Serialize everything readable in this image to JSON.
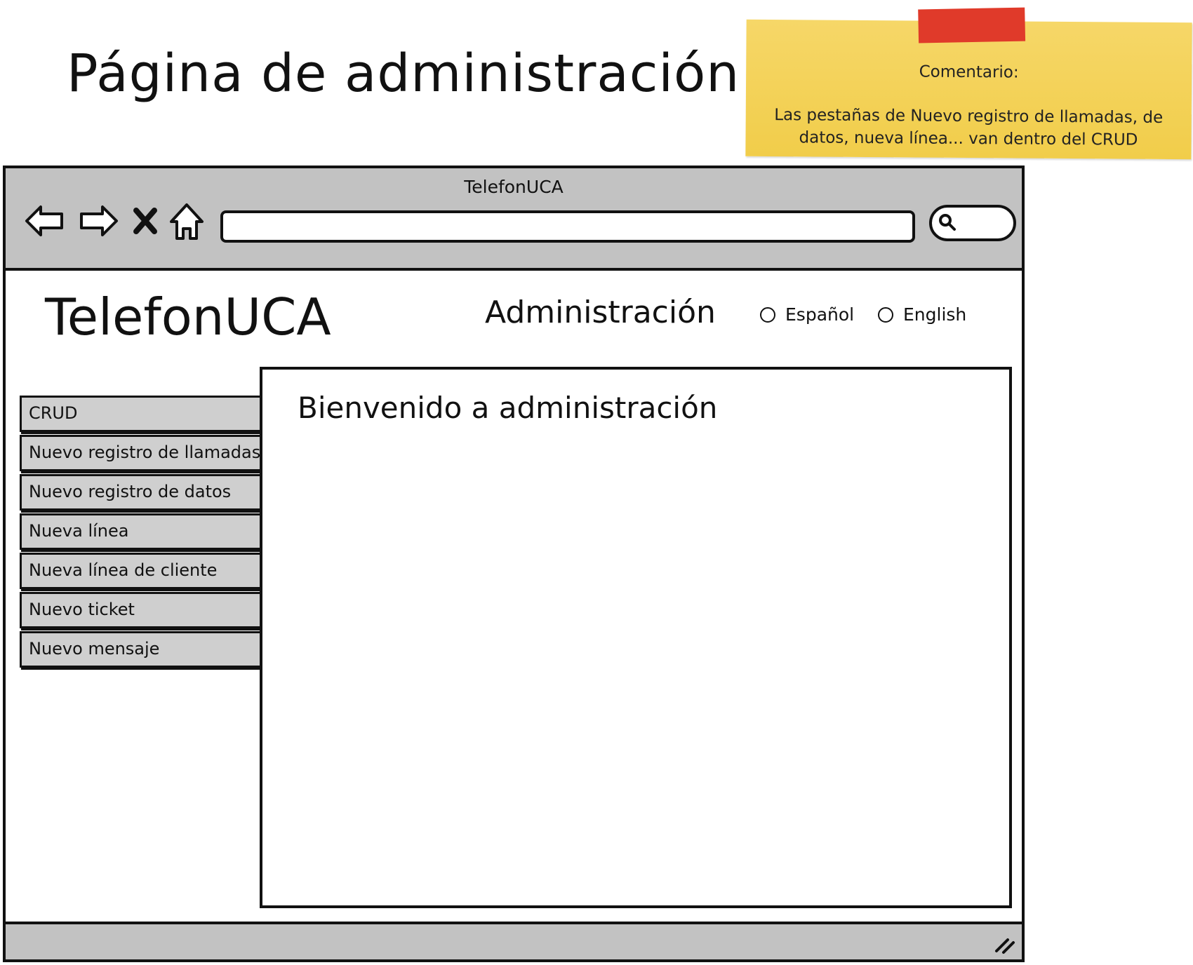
{
  "page_heading": "Página de administración",
  "note": {
    "title": "Comentario:",
    "body": "Las pestañas de Nuevo registro de llamadas, de datos, nueva línea... van dentro del CRUD"
  },
  "window": {
    "title": "TelefonUCA",
    "nav_icons": [
      "back-arrow-icon",
      "forward-arrow-icon",
      "close-icon",
      "home-icon"
    ],
    "address_value": "",
    "search_value": ""
  },
  "header": {
    "brand": "TelefonUCA",
    "section_title": "Administración",
    "languages": [
      "Español",
      "English"
    ]
  },
  "sidebar": {
    "items": [
      "CRUD",
      "Nuevo registro de llamadas",
      "Nuevo registro de datos",
      "Nueva línea",
      "Nueva línea de cliente",
      "Nuevo ticket",
      "Nuevo mensaje"
    ]
  },
  "main": {
    "welcome": "Bienvenido a administración"
  },
  "colors": {
    "chrome": "#c2c2c2",
    "tab": "#cfcfcf",
    "note": "#f3d24f",
    "tape": "#e03a2a",
    "stroke": "#111111"
  }
}
